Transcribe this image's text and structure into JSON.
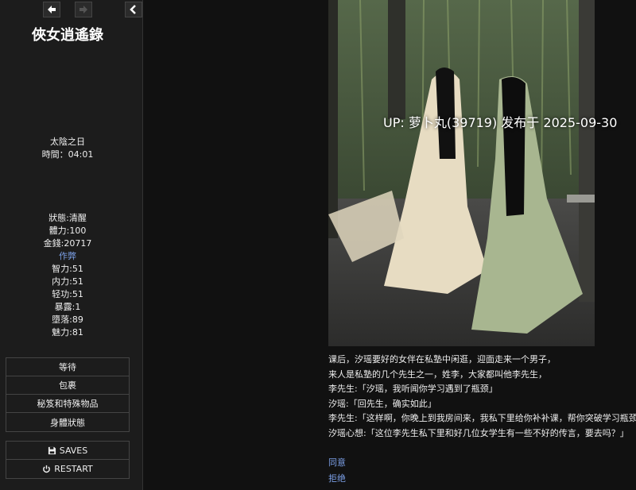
{
  "sidebar": {
    "title": "俠女逍遙錄",
    "time_block": {
      "day": "太陰之日",
      "time": "時間：04:01"
    },
    "stats": {
      "state": "狀態:清醒",
      "stamina": "體力:100",
      "money": "金錢:20717",
      "cheat": "作弊",
      "intelligence": "智力:51",
      "inner_power": "内力:51",
      "qinggong": "轻功:51",
      "exposure": "暴露:1",
      "depravity": "墮落:89",
      "charm": "魅力:81"
    },
    "menu": [
      "等待",
      "包裹",
      "秘笈和特殊物品",
      "身體狀態"
    ],
    "system": {
      "saves": "SAVES",
      "restart": "RESTART"
    }
  },
  "overlay": "UP: 萝卜丸(39719) 发布于 2025-09-30",
  "story": [
    "课后，汐瑶要好的女伴在私塾中闲逛，迎面走来一个男子，",
    "来人是私塾的几个先生之一，姓李，大家都叫他李先生，",
    "李先生:「汐瑶，我听闻你学习遇到了瓶颈」",
    "汐瑶:「回先生，确实如此」",
    "李先生:「这样啊，你晚上到我房间来，我私下里给你补补课，帮你突破学习瓶颈」",
    "汐瑶心想:「这位李先生私下里和好几位女学生有一些不好的传言，要去吗？」"
  ],
  "choices": {
    "agree": "同意",
    "refuse": "拒绝"
  }
}
